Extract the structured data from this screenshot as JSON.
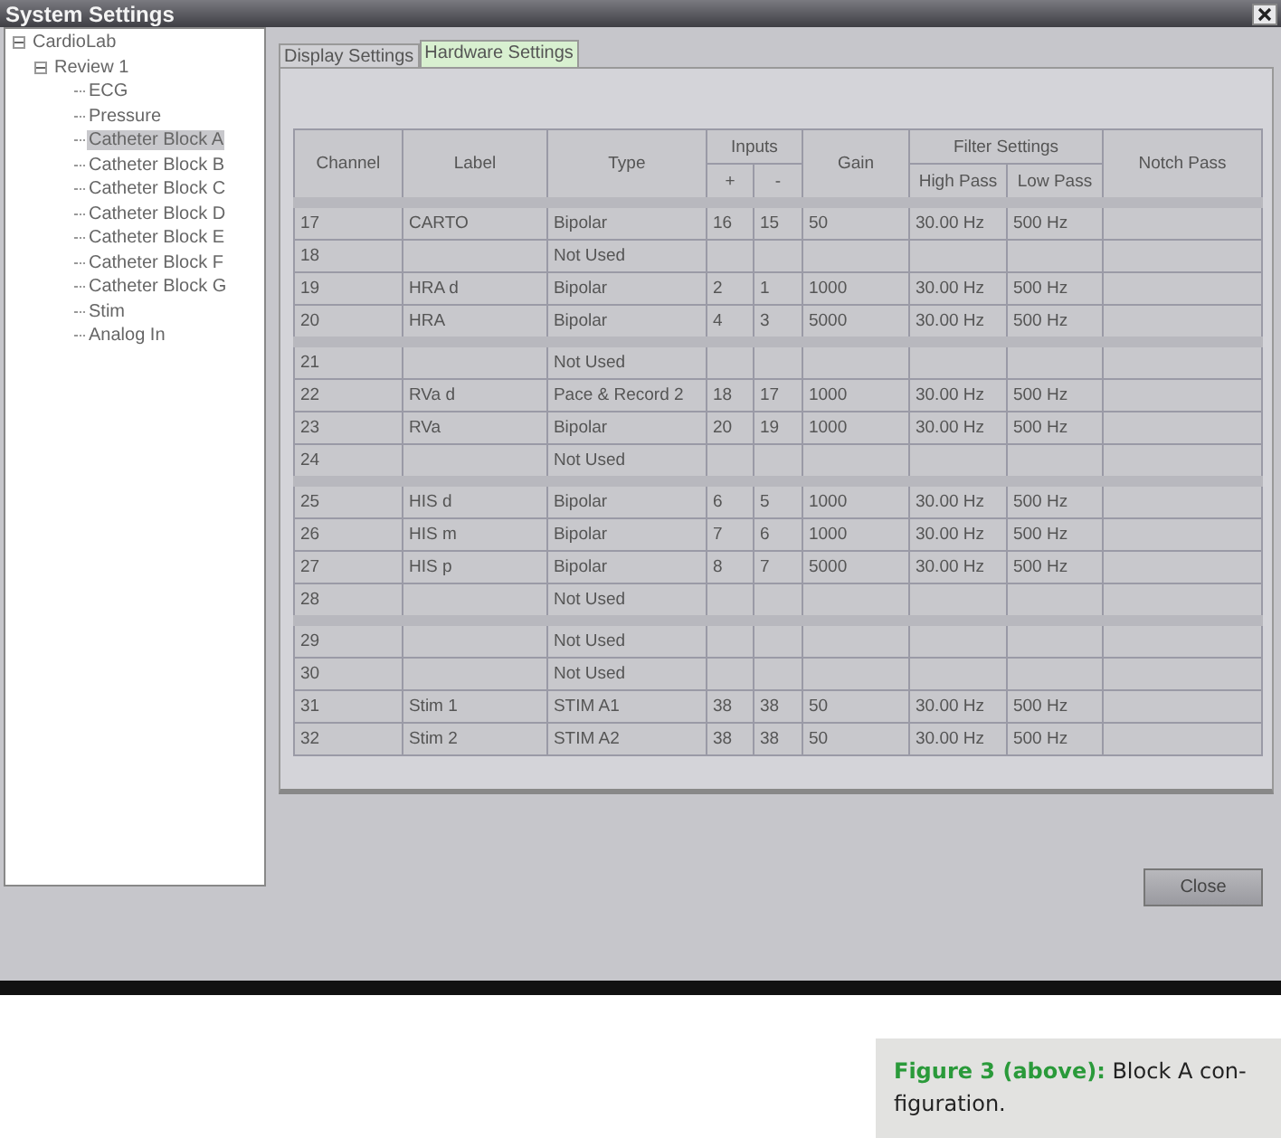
{
  "window": {
    "title": "System Settings"
  },
  "tree": [
    {
      "label": "CardioLab",
      "expanded": true,
      "selected": false,
      "children": [
        {
          "label": "Review 1",
          "expanded": true,
          "selected": false,
          "children": [
            {
              "label": "ECG",
              "selected": false
            },
            {
              "label": "Pressure",
              "selected": false
            },
            {
              "label": "Catheter Block A",
              "selected": true
            },
            {
              "label": "Catheter Block B",
              "selected": false
            },
            {
              "label": "Catheter Block C",
              "selected": false
            },
            {
              "label": "Catheter Block D",
              "selected": false
            },
            {
              "label": "Catheter Block E",
              "selected": false
            },
            {
              "label": "Catheter Block F",
              "selected": false
            },
            {
              "label": "Catheter Block G",
              "selected": false
            },
            {
              "label": "Stim",
              "selected": false
            },
            {
              "label": "Analog In",
              "selected": false
            }
          ]
        }
      ]
    }
  ],
  "tabs": [
    {
      "label": "Display Settings",
      "selected": false
    },
    {
      "label": "Hardware Settings",
      "selected": true
    }
  ],
  "table": {
    "headers": {
      "channel": "Channel",
      "label": "Label",
      "type": "Type",
      "inputs": "Inputs",
      "plus": "+",
      "minus": "-",
      "gain": "Gain",
      "filter": "Filter Settings",
      "high": "High Pass",
      "low": "Low Pass",
      "notch": "Notch Pass"
    },
    "rows": [
      {
        "gap_before": true,
        "cells": [
          "17",
          "CARTO",
          "Bipolar",
          "16",
          "15",
          "50",
          "30.00 Hz",
          "500 Hz",
          ""
        ]
      },
      {
        "gap_before": false,
        "cells": [
          "18",
          "",
          "Not Used",
          "",
          "",
          "",
          "",
          "",
          ""
        ]
      },
      {
        "gap_before": false,
        "cells": [
          "19",
          "HRA d",
          "Bipolar",
          "2",
          "1",
          "1000",
          "30.00 Hz",
          "500 Hz",
          ""
        ]
      },
      {
        "gap_before": false,
        "cells": [
          "20",
          "HRA",
          "Bipolar",
          "4",
          "3",
          "5000",
          "30.00 Hz",
          "500 Hz",
          ""
        ]
      },
      {
        "gap_before": true,
        "cells": [
          "21",
          "",
          "Not Used",
          "",
          "",
          "",
          "",
          "",
          ""
        ]
      },
      {
        "gap_before": false,
        "cells": [
          "22",
          "RVa d",
          "Pace & Record 2",
          "18",
          "17",
          "1000",
          "30.00 Hz",
          "500 Hz",
          ""
        ]
      },
      {
        "gap_before": false,
        "cells": [
          "23",
          "RVa",
          "Bipolar",
          "20",
          "19",
          "1000",
          "30.00 Hz",
          "500 Hz",
          ""
        ]
      },
      {
        "gap_before": false,
        "cells": [
          "24",
          "",
          "Not Used",
          "",
          "",
          "",
          "",
          "",
          ""
        ]
      },
      {
        "gap_before": true,
        "cells": [
          "25",
          "HIS d",
          "Bipolar",
          "6",
          "5",
          "1000",
          "30.00 Hz",
          "500 Hz",
          ""
        ]
      },
      {
        "gap_before": false,
        "cells": [
          "26",
          "HIS m",
          "Bipolar",
          "7",
          "6",
          "1000",
          "30.00 Hz",
          "500 Hz",
          ""
        ]
      },
      {
        "gap_before": false,
        "cells": [
          "27",
          "HIS p",
          "Bipolar",
          "8",
          "7",
          "5000",
          "30.00 Hz",
          "500 Hz",
          ""
        ]
      },
      {
        "gap_before": false,
        "cells": [
          "28",
          "",
          "Not Used",
          "",
          "",
          "",
          "",
          "",
          ""
        ]
      },
      {
        "gap_before": true,
        "cells": [
          "29",
          "",
          "Not Used",
          "",
          "",
          "",
          "",
          "",
          ""
        ]
      },
      {
        "gap_before": false,
        "cells": [
          "30",
          "",
          "Not Used",
          "",
          "",
          "",
          "",
          "",
          ""
        ]
      },
      {
        "gap_before": false,
        "cells": [
          "31",
          "Stim 1",
          "STIM A1",
          "38",
          "38",
          "50",
          "30.00 Hz",
          "500 Hz",
          ""
        ]
      },
      {
        "gap_before": false,
        "cells": [
          "32",
          "Stim 2",
          "STIM A2",
          "38",
          "38",
          "50",
          "30.00 Hz",
          "500 Hz",
          ""
        ]
      }
    ]
  },
  "buttons": {
    "close": "Close"
  },
  "caption": "**Figure 3 (above):** Block A con-figuration."
}
